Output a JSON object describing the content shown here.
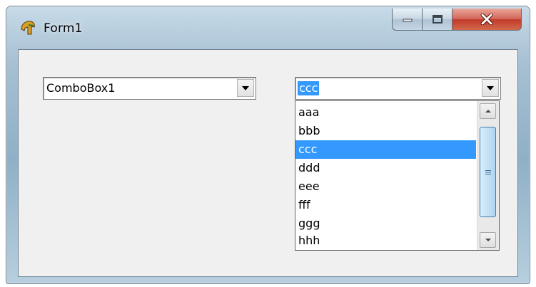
{
  "window": {
    "title": "Form1",
    "icon": "delphi-helmet-icon",
    "controls": [
      "minimize-icon",
      "maximize-icon",
      "close-icon"
    ]
  },
  "combobox1": {
    "value": "ComboBox1"
  },
  "combobox2": {
    "value": "ccc",
    "options": [
      "aaa",
      "bbb",
      "ccc",
      "ddd",
      "eee",
      "fff",
      "ggg",
      "hhh"
    ],
    "selected_index": 2
  },
  "colors": {
    "selection": "#3399ff",
    "close_button": "#c1392a"
  }
}
